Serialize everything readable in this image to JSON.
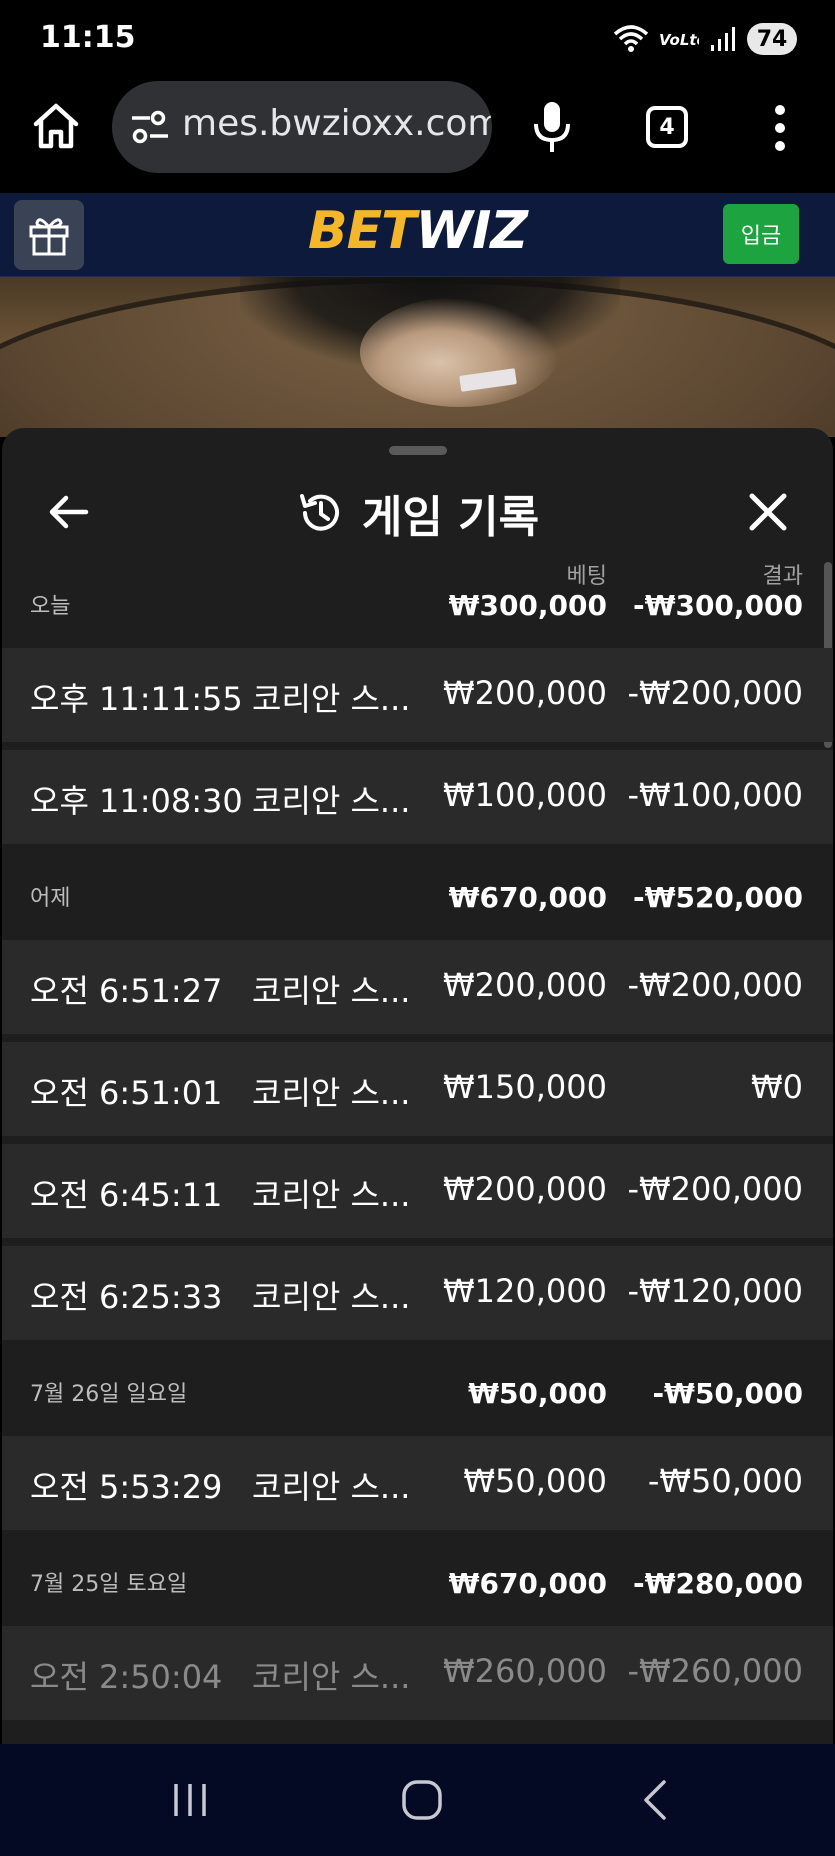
{
  "status_bar": {
    "time": "11:15",
    "battery": "74"
  },
  "browser": {
    "url": "mes.bwzioxx.com",
    "tab_count": "4"
  },
  "site": {
    "logo_bet": "BET",
    "logo_wiz": "WIZ",
    "deposit_label": "입금"
  },
  "sheet": {
    "title": "게임 기록",
    "col_bet": "베팅",
    "col_result": "결과"
  },
  "groups": [
    {
      "label": "오늘",
      "bet_total": "₩300,000",
      "result_total": "-₩300,000",
      "rows": [
        {
          "time": "오후 11:11:55",
          "game": "코리안 스...",
          "bet": "₩200,000",
          "result": "-₩200,000"
        },
        {
          "time": "오후 11:08:30",
          "game": "코리안 스...",
          "bet": "₩100,000",
          "result": "-₩100,000"
        }
      ]
    },
    {
      "label": "어제",
      "bet_total": "₩670,000",
      "result_total": "-₩520,000",
      "rows": [
        {
          "time": "오전 6:51:27",
          "game": "코리안 스...",
          "bet": "₩200,000",
          "result": "-₩200,000"
        },
        {
          "time": "오전 6:51:01",
          "game": "코리안 스...",
          "bet": "₩150,000",
          "result": "₩0"
        },
        {
          "time": "오전 6:45:11",
          "game": "코리안 스...",
          "bet": "₩200,000",
          "result": "-₩200,000"
        },
        {
          "time": "오전 6:25:33",
          "game": "코리안 스...",
          "bet": "₩120,000",
          "result": "-₩120,000"
        }
      ]
    },
    {
      "label": "7월 26일 일요일",
      "bet_total": "₩50,000",
      "result_total": "-₩50,000",
      "rows": [
        {
          "time": "오전 5:53:29",
          "game": "코리안 스...",
          "bet": "₩50,000",
          "result": "-₩50,000"
        }
      ]
    },
    {
      "label": "7월 25일 토요일",
      "bet_total": "₩670,000",
      "result_total": "-₩280,000",
      "rows": [
        {
          "time": "오전 2:50:04",
          "game": "코리안 스...",
          "bet": "₩260,000",
          "result": "-₩260,000"
        }
      ]
    }
  ],
  "colors": {
    "header_bg": "#0d1a3b",
    "deposit_green": "#1da33f",
    "logo_gold": "#f4b62b",
    "sheet_bg": "#1e1e1e",
    "row_bg": "#2a2a2a"
  }
}
